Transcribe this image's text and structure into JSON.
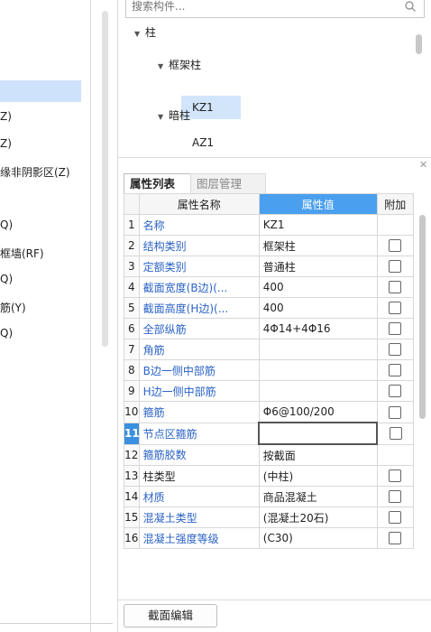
{
  "left_panel": {
    "items": [
      {
        "label": "Z)"
      },
      {
        "label": "Z)"
      },
      {
        "label": "缘非阴影区(Z)"
      },
      {
        "label": "Q)"
      },
      {
        "label": "框墙(RF)"
      },
      {
        "label": "Q)"
      },
      {
        "label": "筋(Y)"
      },
      {
        "label": "Q)"
      }
    ]
  },
  "search": {
    "placeholder": "搜索构件..."
  },
  "tree": {
    "root": "柱",
    "group1": "框架柱",
    "group1_item": "KZ1",
    "group2": "暗柱",
    "group2_item": "AZ1"
  },
  "tabs": {
    "properties": "属性列表",
    "layers": "图层管理"
  },
  "table": {
    "headers": {
      "name": "属性名称",
      "value": "属性值",
      "add": "附加"
    },
    "rows": [
      {
        "idx": "1",
        "name": "名称",
        "value": "KZ1",
        "blue": true,
        "checkbox": false
      },
      {
        "idx": "2",
        "name": "结构类别",
        "value": "框架柱",
        "blue": true,
        "checkbox": true
      },
      {
        "idx": "3",
        "name": "定额类别",
        "value": "普通柱",
        "blue": true,
        "checkbox": true
      },
      {
        "idx": "4",
        "name": "截面宽度(B边)(...",
        "value": "400",
        "blue": true,
        "checkbox": true
      },
      {
        "idx": "5",
        "name": "截面高度(H边)(...",
        "value": "400",
        "blue": true,
        "checkbox": true
      },
      {
        "idx": "6",
        "name": "全部纵筋",
        "value": "4Φ14+4Φ16",
        "blue": true,
        "checkbox": true
      },
      {
        "idx": "7",
        "name": "角筋",
        "value": "",
        "blue": true,
        "checkbox": true
      },
      {
        "idx": "8",
        "name": "B边一侧中部筋",
        "value": "",
        "blue": true,
        "checkbox": true
      },
      {
        "idx": "9",
        "name": "H边一侧中部筋",
        "value": "",
        "blue": true,
        "checkbox": true
      },
      {
        "idx": "10",
        "name": "箍筋",
        "value": "Φ6@100/200",
        "blue": true,
        "checkbox": true
      },
      {
        "idx": "11",
        "name": "节点区箍筋",
        "value": "",
        "blue": true,
        "checkbox": true,
        "active": true
      },
      {
        "idx": "12",
        "name": "箍筋胶数",
        "value": "按截面",
        "blue": true,
        "checkbox": false
      },
      {
        "idx": "13",
        "name": "柱类型",
        "value": "(中柱)",
        "blue": false,
        "checkbox": true
      },
      {
        "idx": "14",
        "name": "材质",
        "value": "商品混凝土",
        "blue": true,
        "checkbox": true
      },
      {
        "idx": "15",
        "name": "混凝土类型",
        "value": "(混凝土20石)",
        "blue": true,
        "checkbox": true
      },
      {
        "idx": "16",
        "name": "混凝土强度等级",
        "value": "(C30)",
        "blue": true,
        "checkbox": true
      }
    ]
  },
  "buttons": {
    "section_edit": "截面编辑"
  },
  "colors": {
    "header_highlight": "#4aa0ee",
    "selection": "#cfe2fb",
    "blue_text": "#2b63c5"
  }
}
